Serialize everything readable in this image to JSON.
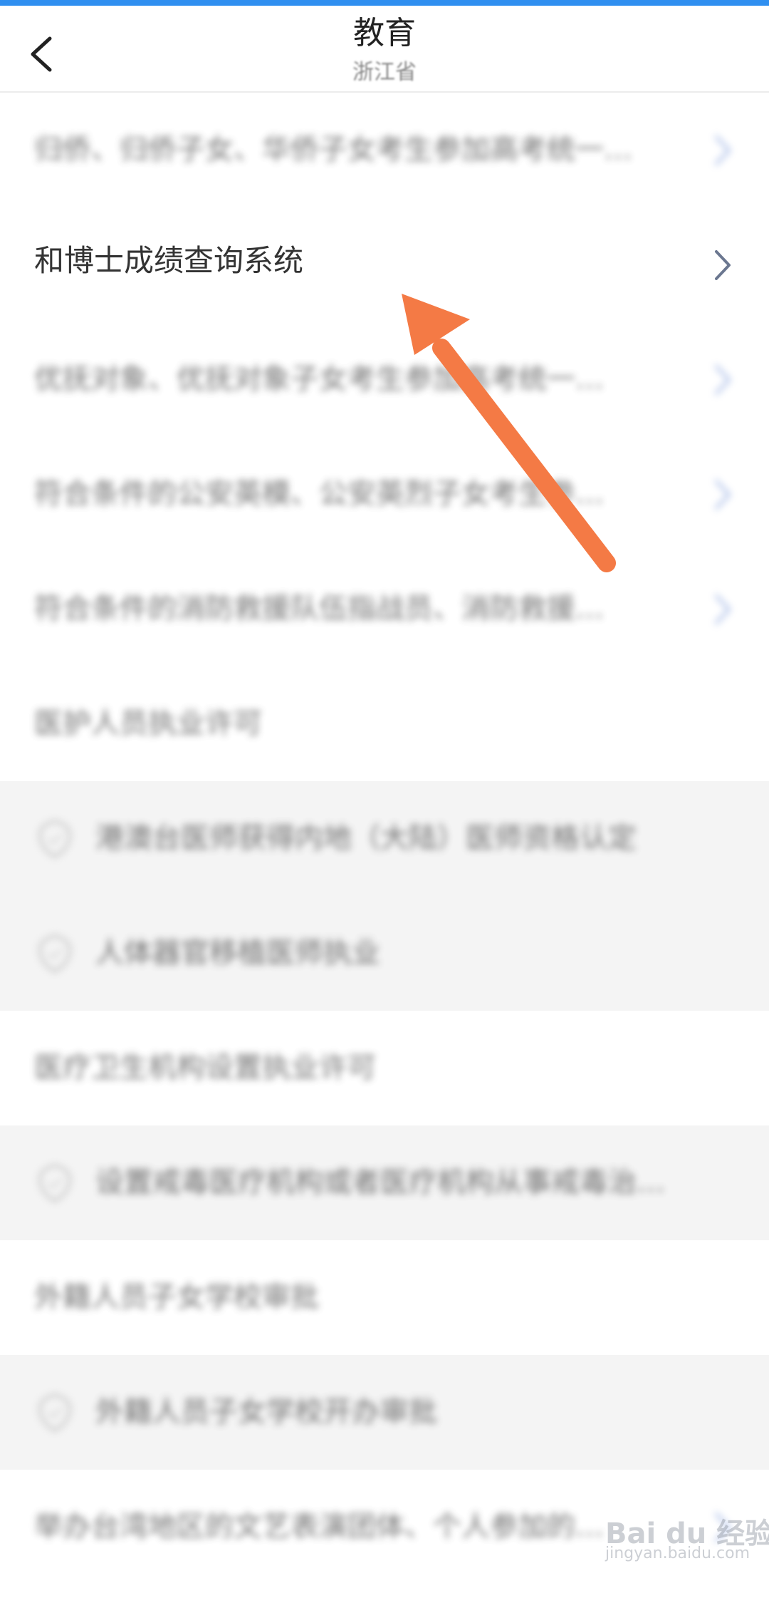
{
  "header": {
    "title": "教育",
    "subtitle": "浙江省"
  },
  "list": {
    "items": [
      {
        "label": "归侨、归侨子女、华侨子女考生参加高考统一…",
        "level": "top",
        "chevron": true,
        "blurred": true
      },
      {
        "label": "和博士成绩查询系统",
        "level": "top",
        "chevron": true,
        "blurred": false
      },
      {
        "label": "优抚对象、优抚对象子女考生参加高考统一…",
        "level": "top",
        "chevron": true,
        "blurred": true
      },
      {
        "label": "符合条件的公安英模、公安英烈子女考生参…",
        "level": "top",
        "chevron": true,
        "blurred": true
      },
      {
        "label": "符合条件的消防救援队伍指战员、消防救援…",
        "level": "top",
        "chevron": true,
        "blurred": true
      },
      {
        "label": "医护人员执业许可",
        "level": "top",
        "chevron": false,
        "blurred": true
      },
      {
        "label": "港澳台医师获得内地（大陆）医师资格认定",
        "level": "sub",
        "chevron": false,
        "blurred": true
      },
      {
        "label": "人体器官移植医师执业",
        "level": "sub",
        "chevron": false,
        "blurred": true
      },
      {
        "label": "医疗卫生机构设置执业许可",
        "level": "top",
        "chevron": false,
        "blurred": true
      },
      {
        "label": "设置戒毒医疗机构或者医疗机构从事戒毒治…",
        "level": "sub",
        "chevron": false,
        "blurred": true
      },
      {
        "label": "外籍人员子女学校审批",
        "level": "top",
        "chevron": false,
        "blurred": true
      },
      {
        "label": "外籍人员子女学校开办审批",
        "level": "sub",
        "chevron": false,
        "blurred": true
      },
      {
        "label": "举办台湾地区的文艺表演团体、个人参加的…",
        "level": "top",
        "chevron": true,
        "blurred": true
      }
    ]
  },
  "watermark": {
    "text": "Bai du 经验",
    "sub": "jingyan.baidu.com"
  },
  "colors": {
    "accent": "#2f8ff0",
    "arrow": "#f47a45",
    "chevron": "#6b7790",
    "chevron_blur": "#8fa8e0"
  },
  "icons": {
    "back": "chevron-left-icon",
    "item": "chevron-right-icon",
    "sub_item": "leaf-shield-icon"
  }
}
